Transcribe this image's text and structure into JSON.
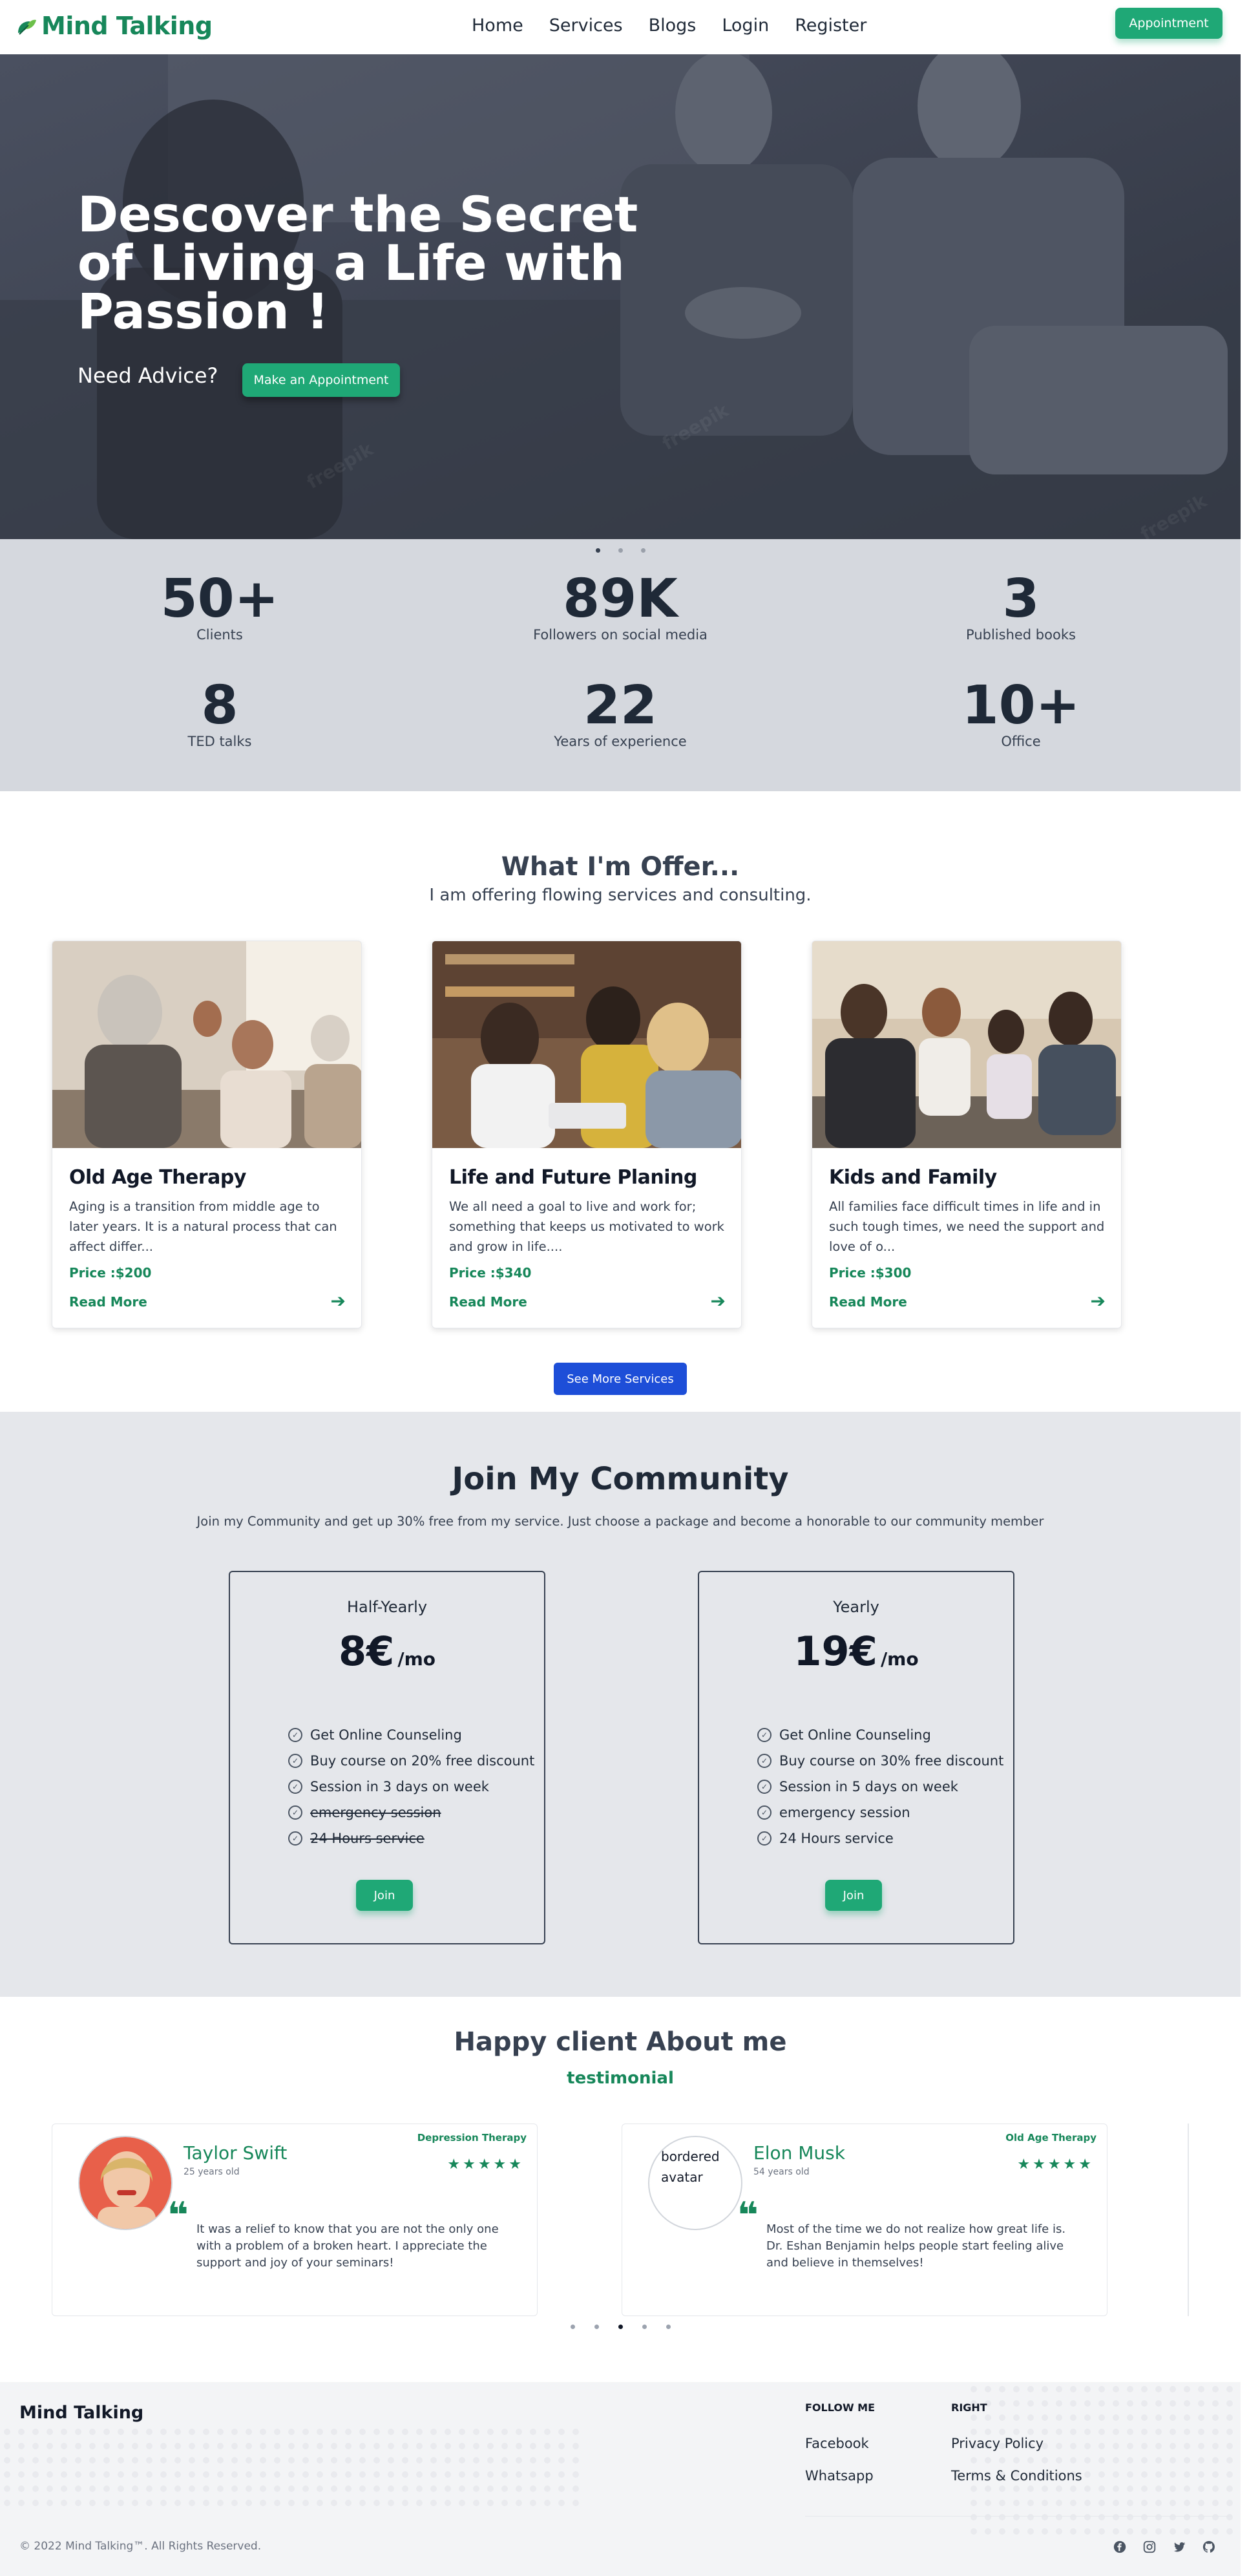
{
  "nav": {
    "brand": "Mind Talking",
    "links": [
      "Home",
      "Services",
      "Blogs",
      "Login",
      "Register"
    ],
    "appointment_button": "Appointment"
  },
  "hero": {
    "title": "Descover the Secret of Living a Life with Passion !",
    "subtitle": "Need Advice?",
    "button": "Make an Appointment",
    "watermark": "freepik"
  },
  "stats": [
    {
      "value": "50+",
      "label": "Clients"
    },
    {
      "value": "89K",
      "label": "Followers on social media"
    },
    {
      "value": "3",
      "label": "Published books"
    },
    {
      "value": "8",
      "label": "TED talks"
    },
    {
      "value": "22",
      "label": "Years of experience"
    },
    {
      "value": "10+",
      "label": "Office"
    }
  ],
  "services": {
    "title": "What I'm Offer...",
    "subtitle": "I am offering flowing services and consulting.",
    "cards": [
      {
        "title": "Old Age Therapy",
        "description": "Aging is a transition from middle age to later years. It is a natural process that can affect differ...",
        "price": "Price :$200",
        "read_more": "Read More"
      },
      {
        "title": "Life and Future Planing",
        "description": "We all need a goal to live and work for; something that keeps us motivated to work and grow in life....",
        "price": "Price :$340",
        "read_more": "Read More"
      },
      {
        "title": "Kids and Family",
        "description": "All families face difficult times in life and in such tough times, we need the support and love of o...",
        "price": "Price :$300",
        "read_more": "Read More"
      }
    ],
    "see_more": "See More Services"
  },
  "community": {
    "title": "Join My Community",
    "subtitle": "Join my Community and get up 30% free from my service. Just choose a package and become a honorable to our community member",
    "plans": [
      {
        "name": "Half-Yearly",
        "price": "8€",
        "per": "/mo",
        "features": [
          {
            "text": "Get Online Counseling",
            "included": true
          },
          {
            "text": "Buy course on 20% free discount",
            "included": true
          },
          {
            "text": "Session in 3 days on week",
            "included": true
          },
          {
            "text": "emergency session",
            "included": false
          },
          {
            "text": "24 Hours service",
            "included": false
          }
        ],
        "button": "Join"
      },
      {
        "name": "Yearly",
        "price": "19€",
        "per": "/mo",
        "features": [
          {
            "text": "Get Online Counseling",
            "included": true
          },
          {
            "text": "Buy course on 30% free discount",
            "included": true
          },
          {
            "text": "Session in 5 days on week",
            "included": true
          },
          {
            "text": "emergency session",
            "included": true
          },
          {
            "text": "24 Hours service",
            "included": true
          }
        ],
        "button": "Join"
      }
    ]
  },
  "testimonials": {
    "title": "Happy client About me",
    "subtitle": "testimonial",
    "items": [
      {
        "name": "Taylor Swift",
        "age": "25 years old",
        "tag": "Depression Therapy",
        "stars": "★★★★★",
        "text": "It was a relief to know that you are not the only one with a problem of a broken heart. I appreciate the support and joy of your seminars!"
      },
      {
        "name": "Elon Musk",
        "age": "54 years old",
        "tag": "Old Age Therapy",
        "stars": "★★★★★",
        "text": "Most of the time we do not realize how great life is. Dr. Eshan Benjamin helps people start feeling alive and believe in themselves!",
        "avatar_alt": "bordered avatar"
      }
    ],
    "quote_mark": "❝"
  },
  "footer": {
    "brand": "Mind Talking",
    "follow_heading": "FOLLOW ME",
    "follow_links": [
      "Facebook",
      "Whatsapp"
    ],
    "right_heading": "RIGHT",
    "right_links": [
      "Privacy Policy",
      "Terms & Conditions"
    ],
    "copyright": "© 2022 Mind Talking™. All Rights Reserved.",
    "social_icons": [
      "facebook-icon",
      "instagram-icon",
      "twitter-icon",
      "github-icon"
    ]
  },
  "colors": {
    "brand_green": "#17875a",
    "button_green": "#1fa876",
    "button_blue": "#1d4ed8",
    "stats_bg": "#d5d8de",
    "community_bg": "#e5e7eb"
  }
}
